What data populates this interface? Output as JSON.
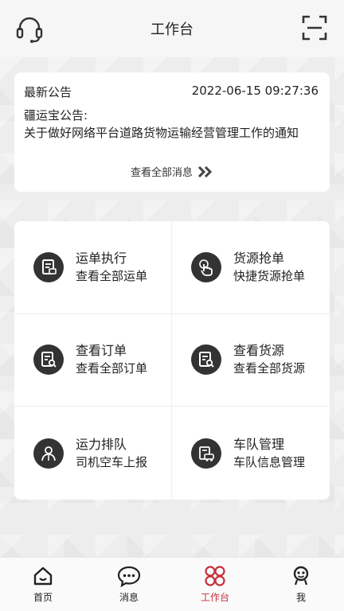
{
  "header": {
    "title": "工作台",
    "left_icon": "headset-icon",
    "right_icon": "scan-icon"
  },
  "notice": {
    "label": "最新公告",
    "time": "2022-06-15 09:27:36",
    "source": "疆运宝公告:",
    "content": "关于做好网络平台道路货物运输经营管理工作的通知",
    "more_label": "查看全部消息"
  },
  "menu": [
    {
      "title": "运单执行",
      "subtitle": "查看全部运单",
      "icon": "waybill-icon"
    },
    {
      "title": "货源抢单",
      "subtitle": "快捷货源抢单",
      "icon": "tap-hand-icon"
    },
    {
      "title": "查看订单",
      "subtitle": "查看全部订单",
      "icon": "order-search-icon"
    },
    {
      "title": "查看货源",
      "subtitle": "查看全部货源",
      "icon": "cargo-search-icon"
    },
    {
      "title": "运力排队",
      "subtitle": "司机空车上报",
      "icon": "driver-queue-icon"
    },
    {
      "title": "车队管理",
      "subtitle": "车队信息管理",
      "icon": "fleet-icon"
    }
  ],
  "tabs": [
    {
      "label": "首页",
      "icon": "home-icon"
    },
    {
      "label": "消息",
      "icon": "chat-icon"
    },
    {
      "label": "工作台",
      "icon": "workbench-icon"
    },
    {
      "label": "我",
      "icon": "profile-icon"
    }
  ],
  "colors": {
    "accent": "#c8303a",
    "icon_dark": "#333333"
  }
}
